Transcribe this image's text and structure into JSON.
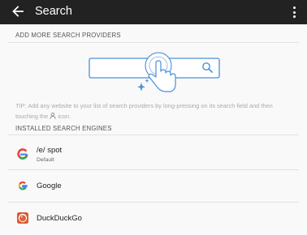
{
  "appbar": {
    "title": "Search"
  },
  "sections": {
    "add_more": "ADD MORE SEARCH PROVIDERS",
    "installed": "INSTALLED SEARCH ENGINES"
  },
  "tip": {
    "before_icon": "TIP: Add any website to your list of search providers by long-pressing on its search field and then touching the",
    "after_icon": "icon."
  },
  "engines": [
    {
      "name": "/e/ spot",
      "subtitle": "Default",
      "icon": "e-spot-icon"
    },
    {
      "name": "Google",
      "icon": "google-icon"
    },
    {
      "name": "DuckDuckGo",
      "icon": "duckduckgo-icon"
    }
  ],
  "colors": {
    "appbar": "#222222",
    "illustration": "#4a90d9",
    "duckduckgo": "#de5833"
  }
}
